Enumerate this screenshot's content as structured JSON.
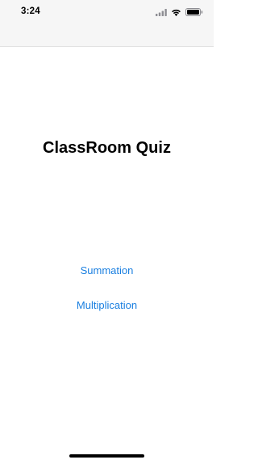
{
  "status_bar": {
    "time": "3:24",
    "icons": [
      "signal-icon",
      "wifi-icon",
      "battery-icon"
    ]
  },
  "main": {
    "title": "ClassRoom Quiz",
    "buttons": [
      {
        "label": "Summation"
      },
      {
        "label": "Multiplication"
      }
    ]
  },
  "colors": {
    "accent": "#1a7fe0",
    "nav_background": "#f6f6f6",
    "text": "#000000"
  }
}
